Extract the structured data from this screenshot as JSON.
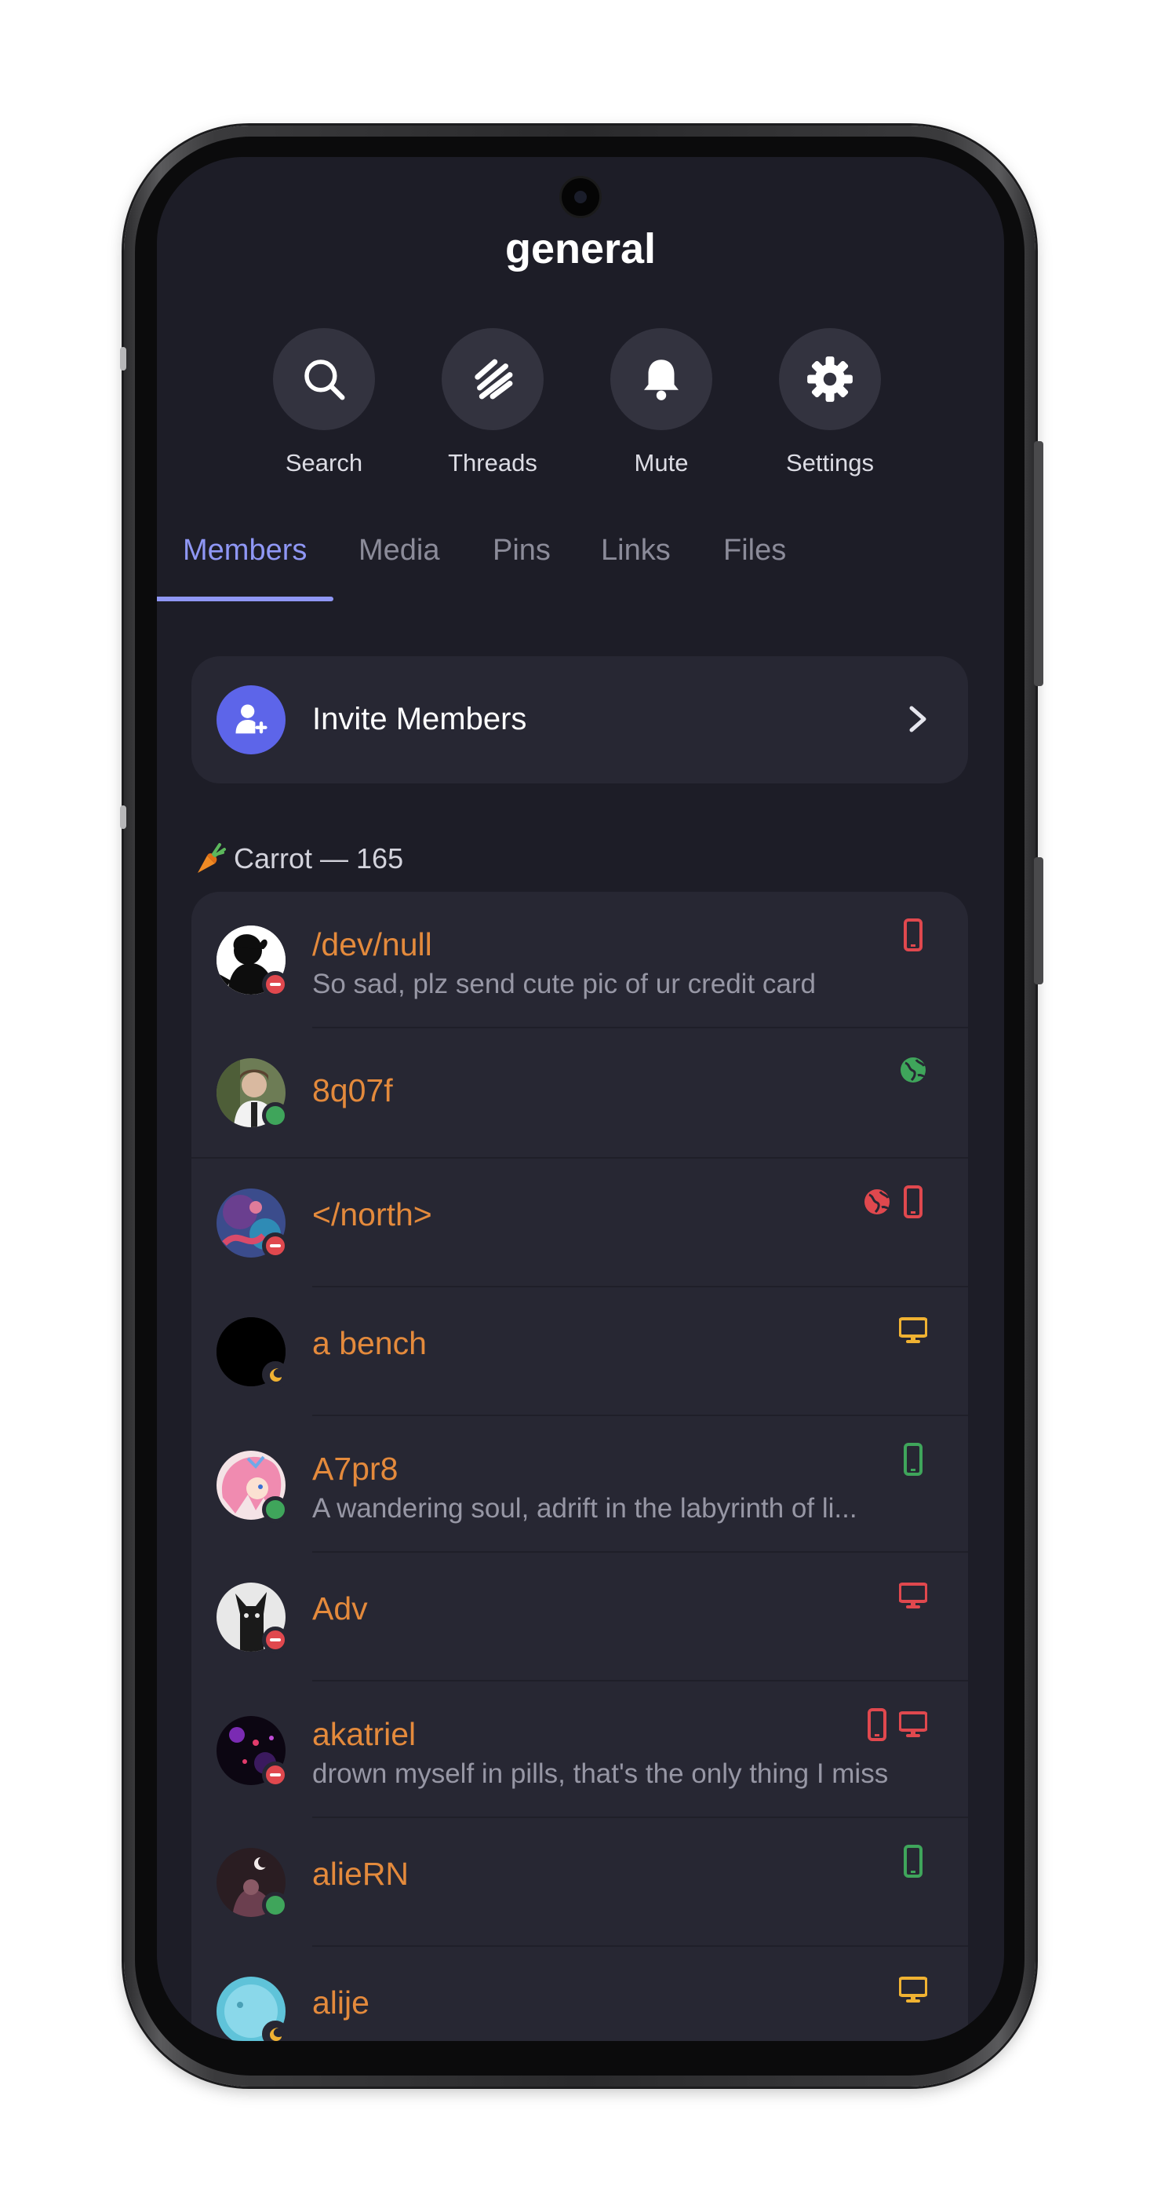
{
  "header": {
    "title": "general"
  },
  "actions": [
    {
      "label": "Search",
      "icon": "search-icon"
    },
    {
      "label": "Threads",
      "icon": "threads-icon"
    },
    {
      "label": "Mute",
      "icon": "bell-icon"
    },
    {
      "label": "Settings",
      "icon": "gear-icon"
    }
  ],
  "tabs": [
    {
      "label": "Members",
      "active": true
    },
    {
      "label": "Media"
    },
    {
      "label": "Pins"
    },
    {
      "label": "Links"
    },
    {
      "label": "Files"
    }
  ],
  "invite": {
    "label": "Invite Members"
  },
  "section": {
    "label": "Carrot — 165",
    "icon": "carrot-icon"
  },
  "members": [
    {
      "name": "/dev/null",
      "status_text": "So sad, plz send cute pic of ur credit card",
      "presence": "dnd",
      "devices": [
        "mobile"
      ],
      "device_color": "#e0484e"
    },
    {
      "name": "8q07f",
      "status_text": "",
      "presence": "online",
      "devices": [
        "web"
      ],
      "device_color": "#3fa55b"
    },
    {
      "name": "</north>",
      "status_text": "",
      "presence": "dnd",
      "devices": [
        "web",
        "mobile"
      ],
      "device_color": "#e0484e"
    },
    {
      "name": "a bench",
      "status_text": "",
      "presence": "idle",
      "devices": [
        "desktop"
      ],
      "device_color": "#f0b232"
    },
    {
      "name": "A7pr8",
      "status_text": "A wandering soul, adrift in the labyrinth of li...",
      "presence": "online",
      "devices": [
        "mobile"
      ],
      "device_color": "#3fa55b"
    },
    {
      "name": "Adv",
      "status_text": "",
      "presence": "dnd",
      "devices": [
        "desktop"
      ],
      "device_color": "#e0484e"
    },
    {
      "name": "akatriel",
      "status_text": "drown myself in pills, that's the only thing I miss",
      "presence": "dnd",
      "devices": [
        "mobile",
        "desktop"
      ],
      "device_color": "#e0484e"
    },
    {
      "name": "alieRN",
      "status_text": "",
      "presence": "online",
      "devices": [
        "mobile"
      ],
      "device_color": "#3fa55b"
    },
    {
      "name": "alije",
      "status_text": "",
      "presence": "idle",
      "devices": [
        "desktop"
      ],
      "device_color": "#f0b232"
    }
  ],
  "colors": {
    "background": "#1d1d27",
    "card": "#272733",
    "accent": "#8f97f5",
    "invite_badge": "#5d65e9",
    "name": "#e48a3c",
    "online": "#3fa55b",
    "dnd": "#e0484e",
    "idle": "#f0b232"
  }
}
